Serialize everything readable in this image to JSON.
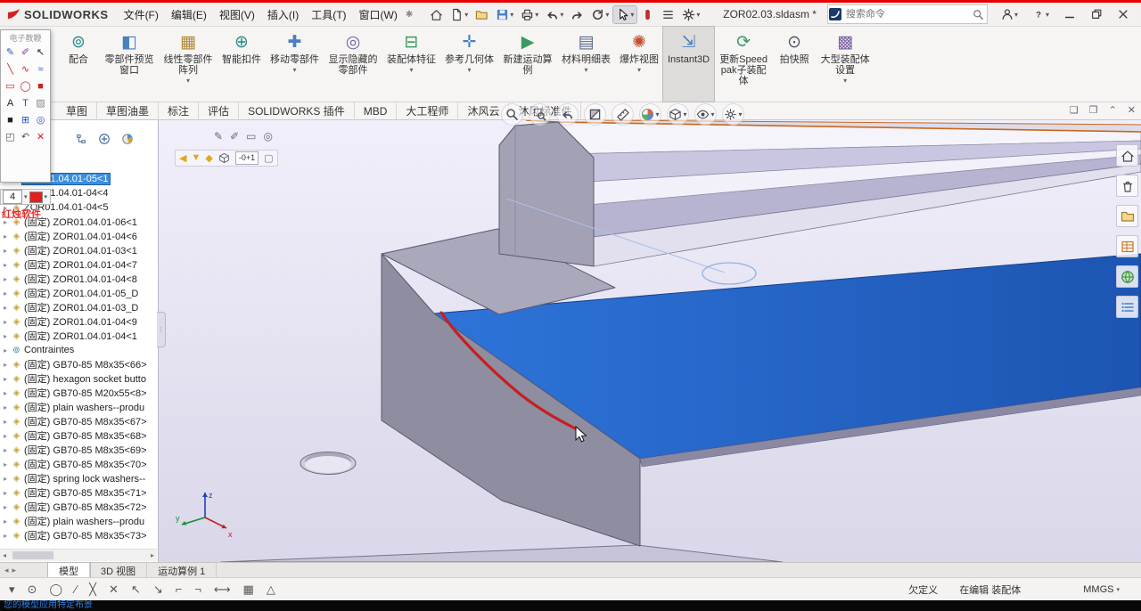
{
  "colors": {
    "selection": "#3c8ede",
    "ink_stroke": "#c81e1e",
    "blue_plate": "#2165cb",
    "viewport_bg": "#e9e7f4",
    "accent_red": "#e60000"
  },
  "window": {
    "brand": "SOLIDWORKS",
    "menus": [
      {
        "label": "文件(F)"
      },
      {
        "label": "编辑(E)"
      },
      {
        "label": "视图(V)"
      },
      {
        "label": "插入(I)"
      },
      {
        "label": "工具(T)"
      },
      {
        "label": "窗口(W)"
      }
    ],
    "pin_glyph": "✱",
    "doc_title": "ZOR02.03.sldasm *",
    "search": {
      "placeholder": "搜索命令"
    },
    "quick_icons": [
      {
        "name": "home-icon",
        "icon": "home"
      },
      {
        "name": "new-document-icon",
        "icon": "doc",
        "dd": true
      },
      {
        "name": "open-icon",
        "icon": "open"
      },
      {
        "name": "save-icon",
        "icon": "save",
        "dd": true
      },
      {
        "name": "print-icon",
        "icon": "print",
        "dd": true
      },
      {
        "name": "undo-icon",
        "icon": "undo",
        "dd": true
      },
      {
        "name": "redo-icon",
        "icon": "redo"
      },
      {
        "name": "rebuild-icon",
        "icon": "rebuild",
        "dd": true
      },
      {
        "name": "select-cursor-icon",
        "icon": "cursor",
        "dd": true,
        "active": true
      },
      {
        "name": "toggle-icon",
        "icon": "toggle"
      },
      {
        "name": "task-pane-icon",
        "icon": "list"
      },
      {
        "name": "options-gear-icon",
        "icon": "gear",
        "dd": true
      }
    ],
    "window_icons": [
      {
        "name": "user-account-icon",
        "icon": "person",
        "dd": true
      },
      {
        "name": "help-icon",
        "icon": "help",
        "dd": true
      },
      {
        "name": "minimize-icon",
        "icon": "min"
      },
      {
        "name": "restore-icon",
        "icon": "restore"
      },
      {
        "name": "close-icon",
        "icon": "close"
      }
    ]
  },
  "ribbon": {
    "buttons": [
      {
        "label": "配合",
        "glyph": "⊚",
        "color": "#2e8b8b"
      },
      {
        "label": "零部件预览窗口",
        "glyph": "◧",
        "color": "#4a7fc0"
      },
      {
        "label": "线性零部件阵列",
        "glyph": "▦",
        "color": "#b08830",
        "dd": true
      },
      {
        "label": "智能扣件",
        "glyph": "⊕",
        "color": "#2e8b8b"
      },
      {
        "label": "移动零部件",
        "glyph": "✚",
        "color": "#4a7fc0",
        "dd": true
      },
      {
        "label": "显示隐藏的零部件",
        "glyph": "◎",
        "color": "#7a5fa0"
      },
      {
        "label": "装配体特征",
        "glyph": "⊟",
        "color": "#3a9a5f",
        "dd": true
      },
      {
        "label": "参考几何体",
        "glyph": "✛",
        "color": "#4a7fc0",
        "dd": true
      },
      {
        "label": "新建运动算例",
        "glyph": "▶",
        "color": "#3a9a5f"
      },
      {
        "label": "材料明细表",
        "glyph": "▤",
        "color": "#5a6a8a",
        "dd": true
      },
      {
        "label": "爆炸视图",
        "glyph": "✺",
        "color": "#c05030",
        "dd": true
      },
      {
        "label": "Instant3D",
        "glyph": "⇲",
        "color": "#4a7fc0",
        "pressed": true
      },
      {
        "label": "更新Speedpak子装配体",
        "glyph": "⟳",
        "color": "#3a9a5f"
      },
      {
        "label": "拍快照",
        "glyph": "⊙",
        "color": "#555566"
      },
      {
        "label": "大型装配体设置",
        "glyph": "▩",
        "color": "#7a5fa0",
        "dd": true
      }
    ]
  },
  "tabs": {
    "items": [
      {
        "label": "草图"
      },
      {
        "label": "草图油墨"
      },
      {
        "label": "标注"
      },
      {
        "label": "评估"
      },
      {
        "label": "SOLIDWORKS 插件"
      },
      {
        "label": "MBD"
      },
      {
        "label": "大工程师"
      },
      {
        "label": "沐风云"
      },
      {
        "label": "沐风标准件"
      }
    ],
    "right_icons": [
      {
        "name": "pane-icon",
        "glyph": "❏"
      },
      {
        "name": "pane-alt-icon",
        "glyph": "❐"
      },
      {
        "name": "collapse-ribbon-icon",
        "glyph": "⌃"
      },
      {
        "name": "close-view-icon",
        "glyph": "✕"
      }
    ]
  },
  "palette": {
    "title": "电子教鞭",
    "vendor": "红烛软件",
    "pen_size": "4",
    "icons": [
      {
        "name": "pen-icon",
        "glyph": "✎",
        "color": "#2255cc"
      },
      {
        "name": "marker-icon",
        "glyph": "✐",
        "color": "#8040a0"
      },
      {
        "name": "arrow-pointer-icon",
        "glyph": "↖",
        "color": "#222222"
      },
      {
        "name": "line-icon",
        "glyph": "╲",
        "color": "#cc2222"
      },
      {
        "name": "curve-icon",
        "glyph": "∿",
        "color": "#cc2222"
      },
      {
        "name": "freehand-icon",
        "glyph": "≈",
        "color": "#2255cc"
      },
      {
        "name": "rect-icon",
        "glyph": "▭",
        "color": "#cc2222"
      },
      {
        "name": "ellipse-icon",
        "glyph": "◯",
        "color": "#cc2222"
      },
      {
        "name": "filled-rect-icon",
        "glyph": "■",
        "color": "#cc2222"
      },
      {
        "name": "text-icon",
        "glyph": "A",
        "color": "#222222"
      },
      {
        "name": "label-icon",
        "glyph": "T",
        "color": "#2255cc"
      },
      {
        "name": "eraser-icon",
        "glyph": "▨",
        "color": "#888888"
      },
      {
        "name": "blackboard-icon",
        "glyph": "■",
        "color": "#222222"
      },
      {
        "name": "grid-icon",
        "glyph": "⊞",
        "color": "#2255cc"
      },
      {
        "name": "zoom-icon",
        "glyph": "◎",
        "color": "#2255cc"
      },
      {
        "name": "save-screenshot-icon",
        "glyph": "◰",
        "color": "#555555"
      },
      {
        "name": "undo-icon",
        "glyph": "↶",
        "color": "#555555"
      },
      {
        "name": "exit-icon",
        "glyph": "✕",
        "color": "#cc2222"
      }
    ]
  },
  "mini_toolbar": {
    "row1": [
      {
        "name": "pen-icon",
        "glyph": "✎"
      },
      {
        "name": "marker-icon",
        "glyph": "✐"
      },
      {
        "name": "eraser-icon",
        "glyph": "▭"
      },
      {
        "name": "lens-icon",
        "glyph": "◎"
      }
    ],
    "row2_arrows": [
      {
        "name": "arrow-left-icon",
        "glyph": "◀",
        "color": "#e0a820"
      },
      {
        "name": "arrow-down-icon",
        "glyph": "▼",
        "color": "#e0a820"
      },
      {
        "name": "arrow-diamond-icon",
        "glyph": "◆",
        "color": "#e0a820"
      }
    ],
    "angle_readout": "-0+1",
    "row2_tail": [
      {
        "name": "box-select-icon",
        "glyph": "▢",
        "color": "#778"
      }
    ]
  },
  "tree": {
    "toolbar_icons": [
      {
        "name": "display-pane-icon",
        "icon": "tree"
      },
      {
        "name": "add-item-icon",
        "icon": "plus"
      },
      {
        "name": "appearance-pie-icon",
        "icon": "pie"
      }
    ],
    "items": [
      {
        "label": "ZOR01.04.01-05<1",
        "selected": true
      },
      {
        "label": "ZOR01.04.01-04<4"
      },
      {
        "label": "ZOR01.04.01-04<5"
      },
      {
        "label": "(固定) ZOR01.04.01-06<1"
      },
      {
        "label": "(固定) ZOR01.04.01-04<6"
      },
      {
        "label": "(固定) ZOR01.04.01-03<1"
      },
      {
        "label": "(固定) ZOR01.04.01-04<7"
      },
      {
        "label": "(固定) ZOR01.04.01-04<8"
      },
      {
        "label": "(固定) ZOR01.04.01-05_D"
      },
      {
        "label": "(固定) ZOR01.04.01-03_D"
      },
      {
        "label": "(固定) ZOR01.04.01-04<9"
      },
      {
        "label": "(固定) ZOR01.04.01-04<1"
      },
      {
        "label": "Contraintes",
        "type": "mates"
      },
      {
        "label": "(固定) GB70-85 M8x35<66>"
      },
      {
        "label": "(固定) hexagon socket butto"
      },
      {
        "label": "(固定) GB70-85 M20x55<8>"
      },
      {
        "label": "(固定) plain washers--produ"
      },
      {
        "label": "(固定) GB70-85 M8x35<67>"
      },
      {
        "label": "(固定) GB70-85 M8x35<68>"
      },
      {
        "label": "(固定) GB70-85 M8x35<69>"
      },
      {
        "label": "(固定) GB70-85 M8x35<70>"
      },
      {
        "label": "(固定) spring lock washers--"
      },
      {
        "label": "(固定) GB70-85 M8x35<71>"
      },
      {
        "label": "(固定) GB70-85 M8x35<72>"
      },
      {
        "label": "(固定) plain washers--produ"
      },
      {
        "label": "(固定) GB70-85 M8x35<73>"
      }
    ]
  },
  "hud": {
    "icons": [
      {
        "name": "zoom-fit-icon",
        "icon": "magnify"
      },
      {
        "name": "zoom-area-icon",
        "icon": "magnifyarea"
      },
      {
        "name": "previous-view-icon",
        "icon": "undo"
      },
      {
        "name": "section-view-icon",
        "icon": "section"
      },
      {
        "name": "measure-icon",
        "icon": "measure"
      },
      {
        "name": "view-orientation-icon",
        "icon": "sphere",
        "dd": true
      },
      {
        "name": "display-style-icon",
        "icon": "cube",
        "dd": true
      },
      {
        "name": "hide-show-items-icon",
        "icon": "eye",
        "dd": true
      },
      {
        "name": "view-settings-icon",
        "icon": "settings",
        "dd": true
      }
    ]
  },
  "right_rail": {
    "icons": [
      {
        "name": "home-icon",
        "icon": "home"
      },
      {
        "name": "delete-icon",
        "icon": "trash"
      },
      {
        "name": "folder-icon",
        "icon": "folder"
      },
      {
        "name": "bom-table-icon",
        "icon": "bom"
      },
      {
        "name": "web-globe-icon",
        "icon": "globe"
      },
      {
        "name": "task-list-icon",
        "icon": "listblue"
      }
    ]
  },
  "view_tabs": {
    "items": [
      {
        "label": "模型",
        "active": true
      },
      {
        "label": "3D 视图"
      },
      {
        "label": "运动算例 1"
      }
    ]
  },
  "ink_toolbar": {
    "icons": [
      {
        "name": "more-icon",
        "glyph": "▾"
      },
      {
        "name": "circle-tool-icon",
        "glyph": "⊙"
      },
      {
        "name": "ellipse-tool-icon",
        "glyph": "◯"
      },
      {
        "name": "line-tool-icon",
        "glyph": "∕"
      },
      {
        "name": "cross-tool-icon",
        "glyph": "╳"
      },
      {
        "name": "delete-stroke-icon",
        "glyph": "✕"
      },
      {
        "name": "arrow-nw-icon",
        "glyph": "↖"
      },
      {
        "name": "arrow-se-icon",
        "glyph": "↘"
      },
      {
        "name": "corner-left-icon",
        "glyph": "⌐"
      },
      {
        "name": "corner-right-icon",
        "glyph": "¬"
      },
      {
        "name": "dimension-tool-icon",
        "glyph": "⟷"
      },
      {
        "name": "grid-tool-icon",
        "glyph": "▦"
      },
      {
        "name": "triangle-tool-icon",
        "glyph": "△"
      }
    ]
  },
  "status": {
    "definition": "欠定义",
    "editing": "在编辑 装配体",
    "units": "MMGS"
  },
  "taskbar": {
    "message": "您的模型应用特定布景"
  },
  "viewport": {
    "triad": {
      "x": "x",
      "y": "y",
      "z": "z"
    }
  }
}
